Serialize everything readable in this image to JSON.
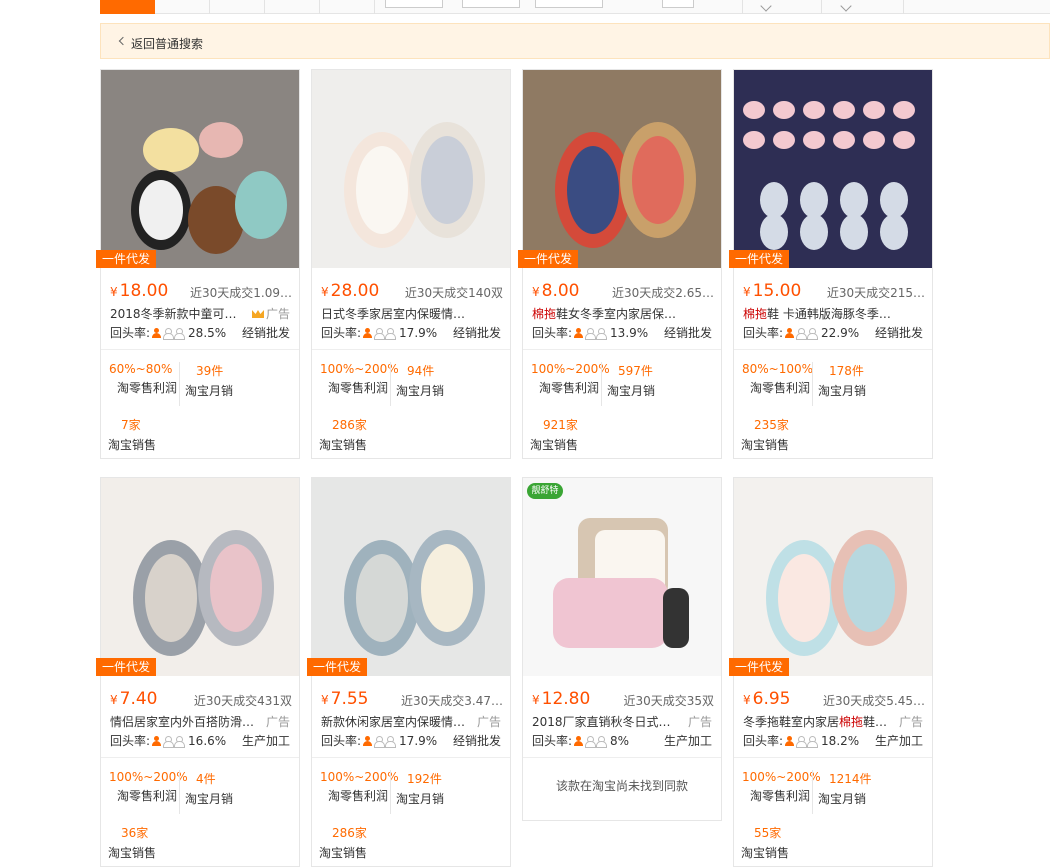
{
  "back_link": {
    "label": "返回普通搜索"
  },
  "colors": {
    "accent": "#ff6a00",
    "price": "#ff5000",
    "banner_bg": "#fff4e5"
  },
  "products": [
    {
      "price": "18.00",
      "sold": "近30天成交1.09…",
      "title": "2018冬季新款中童可…",
      "title_hl": "",
      "ad": "广告",
      "ad_crown": true,
      "rate": "28.5%",
      "mode": "经销批发",
      "badge": "一件代发",
      "profit": "60%~80%",
      "monthly": "39件",
      "shops": "7家",
      "profit_label": "淘零售利润",
      "monthly_label": "淘宝月销",
      "shops_label": "淘宝销售",
      "rate_label": "回头率:"
    },
    {
      "price": "28.00",
      "sold": "近30天成交140双",
      "title": "日式冬季家居室内保暖情侣拖鞋…",
      "title_hl": "",
      "ad": "",
      "ad_crown": false,
      "rate": "17.9%",
      "mode": "经销批发",
      "badge": "",
      "profit": "100%~200%",
      "monthly": "94件",
      "shops": "286家",
      "profit_label": "淘零售利润",
      "monthly_label": "淘宝月销",
      "shops_label": "淘宝销售",
      "rate_label": "回头率:"
    },
    {
      "price": "8.00",
      "sold": "近30天成交2.65…",
      "title": "鞋女冬季室内家居保暖情侣…",
      "title_hl": "棉拖",
      "ad": "",
      "ad_crown": false,
      "rate": "13.9%",
      "mode": "经销批发",
      "badge": "一件代发",
      "profit": "100%~200%",
      "monthly": "597件",
      "shops": "921家",
      "profit_label": "淘零售利润",
      "monthly_label": "淘宝月销",
      "shops_label": "淘宝销售",
      "rate_label": "回头率:"
    },
    {
      "price": "15.00",
      "sold": "近30天成交215…",
      "title": "鞋 卡通韩版海豚冬季家居…",
      "title_hl": "棉拖",
      "ad": "",
      "ad_crown": false,
      "rate": "22.9%",
      "mode": "经销批发",
      "badge": "一件代发",
      "profit": "80%~100%",
      "monthly": "178件",
      "shops": "235家",
      "profit_label": "淘零售利润",
      "monthly_label": "淘宝月销",
      "shops_label": "淘宝销售",
      "rate_label": "回头率:"
    },
    {
      "price": "7.40",
      "sold": "近30天成交431双",
      "title": "情侣居家室内外百搭防滑…",
      "title_hl": "",
      "ad": "广告",
      "ad_crown": false,
      "rate": "16.6%",
      "mode": "生产加工",
      "badge": "一件代发",
      "profit": "100%~200%",
      "monthly": "4件",
      "shops": "36家",
      "profit_label": "淘零售利润",
      "monthly_label": "淘宝月销",
      "shops_label": "淘宝销售",
      "rate_label": "回头率:"
    },
    {
      "price": "7.55",
      "sold": "近30天成交3.47…",
      "title": "新款休闲家居室内保暖情…",
      "title_hl": "",
      "ad": "广告",
      "ad_crown": false,
      "rate": "17.9%",
      "mode": "经销批发",
      "badge": "一件代发",
      "profit": "100%~200%",
      "monthly": "192件",
      "shops": "286家",
      "profit_label": "淘零售利润",
      "monthly_label": "淘宝月销",
      "shops_label": "淘宝销售",
      "rate_label": "回头率:"
    },
    {
      "price": "12.80",
      "sold": "近30天成交35双",
      "title": "2018厂家直销秋冬日式…",
      "title_hl": "",
      "ad": "广告",
      "ad_crown": false,
      "rate": "8%",
      "mode": "生产加工",
      "badge": "",
      "green_badge": "靓舒特",
      "no_match": "该款在淘宝尚未找到同款",
      "rate_label": "回头率:"
    },
    {
      "price": "6.95",
      "sold": "近30天成交5.45…",
      "title_pre": "冬季拖鞋室内家居",
      "title": "鞋…",
      "title_hl": "棉拖",
      "ad": "广告",
      "ad_crown": false,
      "rate": "18.2%",
      "mode": "生产加工",
      "badge": "一件代发",
      "profit": "100%~200%",
      "monthly": "1214件",
      "shops": "55家",
      "profit_label": "淘零售利润",
      "monthly_label": "淘宝月销",
      "shops_label": "淘宝销售",
      "rate_label": "回头率:"
    }
  ]
}
